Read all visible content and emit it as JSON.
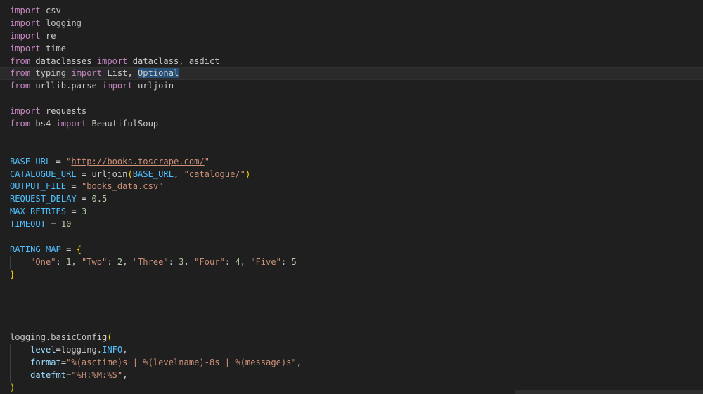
{
  "editor": {
    "lines": [
      {
        "tokens": [
          {
            "t": "import",
            "c": "kw"
          },
          {
            "t": " csv",
            "c": "plain"
          }
        ]
      },
      {
        "tokens": [
          {
            "t": "import",
            "c": "kw"
          },
          {
            "t": " logging",
            "c": "plain"
          }
        ]
      },
      {
        "tokens": [
          {
            "t": "import",
            "c": "kw"
          },
          {
            "t": " re",
            "c": "plain"
          }
        ]
      },
      {
        "tokens": [
          {
            "t": "import",
            "c": "kw"
          },
          {
            "t": " time",
            "c": "plain"
          }
        ]
      },
      {
        "tokens": [
          {
            "t": "from",
            "c": "kw"
          },
          {
            "t": " dataclasses ",
            "c": "plain"
          },
          {
            "t": "import",
            "c": "kw"
          },
          {
            "t": " dataclass, asdict",
            "c": "plain"
          }
        ]
      },
      {
        "current": true,
        "cursor": true,
        "tokens": [
          {
            "t": "from",
            "c": "kw"
          },
          {
            "t": " typing ",
            "c": "plain"
          },
          {
            "t": "import",
            "c": "kw"
          },
          {
            "t": " List, ",
            "c": "plain"
          },
          {
            "t": "Optional",
            "c": "hl"
          }
        ]
      },
      {
        "tokens": [
          {
            "t": "from",
            "c": "kw"
          },
          {
            "t": " urllib.parse ",
            "c": "plain"
          },
          {
            "t": "import",
            "c": "kw"
          },
          {
            "t": " urljoin",
            "c": "plain"
          }
        ]
      },
      {
        "tokens": []
      },
      {
        "tokens": [
          {
            "t": "import",
            "c": "kw"
          },
          {
            "t": " requests",
            "c": "plain"
          }
        ]
      },
      {
        "tokens": [
          {
            "t": "from",
            "c": "kw"
          },
          {
            "t": " bs4 ",
            "c": "plain"
          },
          {
            "t": "import",
            "c": "kw"
          },
          {
            "t": " BeautifulSoup",
            "c": "plain"
          }
        ]
      },
      {
        "tokens": []
      },
      {
        "tokens": []
      },
      {
        "tokens": [
          {
            "t": "BASE_URL",
            "c": "const"
          },
          {
            "t": " = ",
            "c": "plain"
          },
          {
            "t": "\"",
            "c": "str"
          },
          {
            "t": "http://books.toscrape.com/",
            "c": "str-link"
          },
          {
            "t": "\"",
            "c": "str"
          }
        ]
      },
      {
        "tokens": [
          {
            "t": "CATALOGUE_URL",
            "c": "const"
          },
          {
            "t": " = urljoin",
            "c": "plain"
          },
          {
            "t": "(",
            "c": "paren"
          },
          {
            "t": "BASE_URL",
            "c": "const"
          },
          {
            "t": ", ",
            "c": "plain"
          },
          {
            "t": "\"catalogue/\"",
            "c": "str"
          },
          {
            "t": ")",
            "c": "paren"
          }
        ]
      },
      {
        "tokens": [
          {
            "t": "OUTPUT_FILE",
            "c": "const"
          },
          {
            "t": " = ",
            "c": "plain"
          },
          {
            "t": "\"books_data.csv\"",
            "c": "str"
          }
        ]
      },
      {
        "tokens": [
          {
            "t": "REQUEST_DELAY",
            "c": "const"
          },
          {
            "t": " = ",
            "c": "plain"
          },
          {
            "t": "0.5",
            "c": "num"
          }
        ]
      },
      {
        "tokens": [
          {
            "t": "MAX_RETRIES",
            "c": "const"
          },
          {
            "t": " = ",
            "c": "plain"
          },
          {
            "t": "3",
            "c": "num"
          }
        ]
      },
      {
        "tokens": [
          {
            "t": "TIMEOUT",
            "c": "const"
          },
          {
            "t": " = ",
            "c": "plain"
          },
          {
            "t": "10",
            "c": "num"
          }
        ]
      },
      {
        "tokens": []
      },
      {
        "tokens": [
          {
            "t": "RATING_MAP",
            "c": "const"
          },
          {
            "t": " = ",
            "c": "plain"
          },
          {
            "t": "{",
            "c": "brace"
          }
        ]
      },
      {
        "guide": true,
        "tokens": [
          {
            "t": "    ",
            "c": "plain"
          },
          {
            "t": "\"One\"",
            "c": "str"
          },
          {
            "t": ": ",
            "c": "plain"
          },
          {
            "t": "1",
            "c": "num"
          },
          {
            "t": ", ",
            "c": "plain"
          },
          {
            "t": "\"Two\"",
            "c": "str"
          },
          {
            "t": ": ",
            "c": "plain"
          },
          {
            "t": "2",
            "c": "num"
          },
          {
            "t": ", ",
            "c": "plain"
          },
          {
            "t": "\"Three\"",
            "c": "str"
          },
          {
            "t": ": ",
            "c": "plain"
          },
          {
            "t": "3",
            "c": "num"
          },
          {
            "t": ", ",
            "c": "plain"
          },
          {
            "t": "\"Four\"",
            "c": "str"
          },
          {
            "t": ": ",
            "c": "plain"
          },
          {
            "t": "4",
            "c": "num"
          },
          {
            "t": ", ",
            "c": "plain"
          },
          {
            "t": "\"Five\"",
            "c": "str"
          },
          {
            "t": ": ",
            "c": "plain"
          },
          {
            "t": "5",
            "c": "num"
          }
        ]
      },
      {
        "tokens": [
          {
            "t": "}",
            "c": "brace"
          }
        ]
      },
      {
        "tokens": []
      },
      {
        "tokens": []
      },
      {
        "tokens": []
      },
      {
        "tokens": []
      },
      {
        "tokens": [
          {
            "t": "logging.basicConfig",
            "c": "plain"
          },
          {
            "t": "(",
            "c": "paren"
          }
        ]
      },
      {
        "guide": true,
        "tokens": [
          {
            "t": "    ",
            "c": "plain"
          },
          {
            "t": "level",
            "c": "param"
          },
          {
            "t": "=logging.",
            "c": "plain"
          },
          {
            "t": "INFO",
            "c": "const"
          },
          {
            "t": ",",
            "c": "plain"
          }
        ]
      },
      {
        "guide": true,
        "tokens": [
          {
            "t": "    ",
            "c": "plain"
          },
          {
            "t": "format",
            "c": "param"
          },
          {
            "t": "=",
            "c": "plain"
          },
          {
            "t": "\"",
            "c": "str"
          },
          {
            "t": "%(asctime)s",
            "c": "str"
          },
          {
            "t": " | ",
            "c": "str"
          },
          {
            "t": "%(levelname)-8s",
            "c": "str"
          },
          {
            "t": " | ",
            "c": "str"
          },
          {
            "t": "%(message)s",
            "c": "str"
          },
          {
            "t": "\"",
            "c": "str"
          },
          {
            "t": ",",
            "c": "plain"
          }
        ]
      },
      {
        "guide": true,
        "tokens": [
          {
            "t": "    ",
            "c": "plain"
          },
          {
            "t": "datefmt",
            "c": "param"
          },
          {
            "t": "=",
            "c": "plain"
          },
          {
            "t": "\"",
            "c": "str"
          },
          {
            "t": "%H:%M:%S",
            "c": "str"
          },
          {
            "t": "\"",
            "c": "str"
          },
          {
            "t": ",",
            "c": "plain"
          }
        ]
      },
      {
        "tokens": [
          {
            "t": ")",
            "c": "paren"
          }
        ]
      }
    ]
  }
}
